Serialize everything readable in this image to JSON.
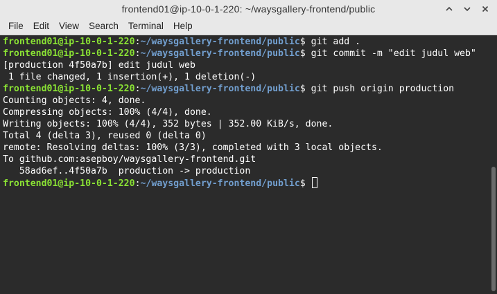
{
  "window": {
    "title": "frontend01@ip-10-0-1-220: ~/waysgallery-frontend/public"
  },
  "menu": {
    "items": [
      "File",
      "Edit",
      "View",
      "Search",
      "Terminal",
      "Help"
    ]
  },
  "icons": {
    "minimize": "minimize-icon",
    "maximize": "maximize-icon",
    "close": "close-icon"
  },
  "colors": {
    "prompt_user": "#8ae234",
    "prompt_path": "#729fcf",
    "terminal_bg": "#2b2b2b",
    "terminal_fg": "#ffffff"
  },
  "prompt": {
    "user": "frontend01@ip-10-0-1-220",
    "path": "~/waysgallery-frontend/public",
    "symbol": "$"
  },
  "lines": [
    {
      "type": "prompt",
      "cmd": " git add ."
    },
    {
      "type": "prompt",
      "cmd": " git commit -m \"edit judul web\""
    },
    {
      "type": "text",
      "text": "[production 4f50a7b] edit judul web"
    },
    {
      "type": "text",
      "text": " 1 file changed, 1 insertion(+), 1 deletion(-)"
    },
    {
      "type": "prompt",
      "cmd": " git push origin production"
    },
    {
      "type": "text",
      "text": "Counting objects: 4, done."
    },
    {
      "type": "text",
      "text": "Compressing objects: 100% (4/4), done."
    },
    {
      "type": "text",
      "text": "Writing objects: 100% (4/4), 352 bytes | 352.00 KiB/s, done."
    },
    {
      "type": "text",
      "text": "Total 4 (delta 3), reused 0 (delta 0)"
    },
    {
      "type": "text",
      "text": "remote: Resolving deltas: 100% (3/3), completed with 3 local objects."
    },
    {
      "type": "text",
      "text": "To github.com:asepboy/waysgallery-frontend.git"
    },
    {
      "type": "text",
      "text": "   58ad6ef..4f50a7b  production -> production"
    },
    {
      "type": "prompt",
      "cmd": " ",
      "cursor": true
    }
  ]
}
